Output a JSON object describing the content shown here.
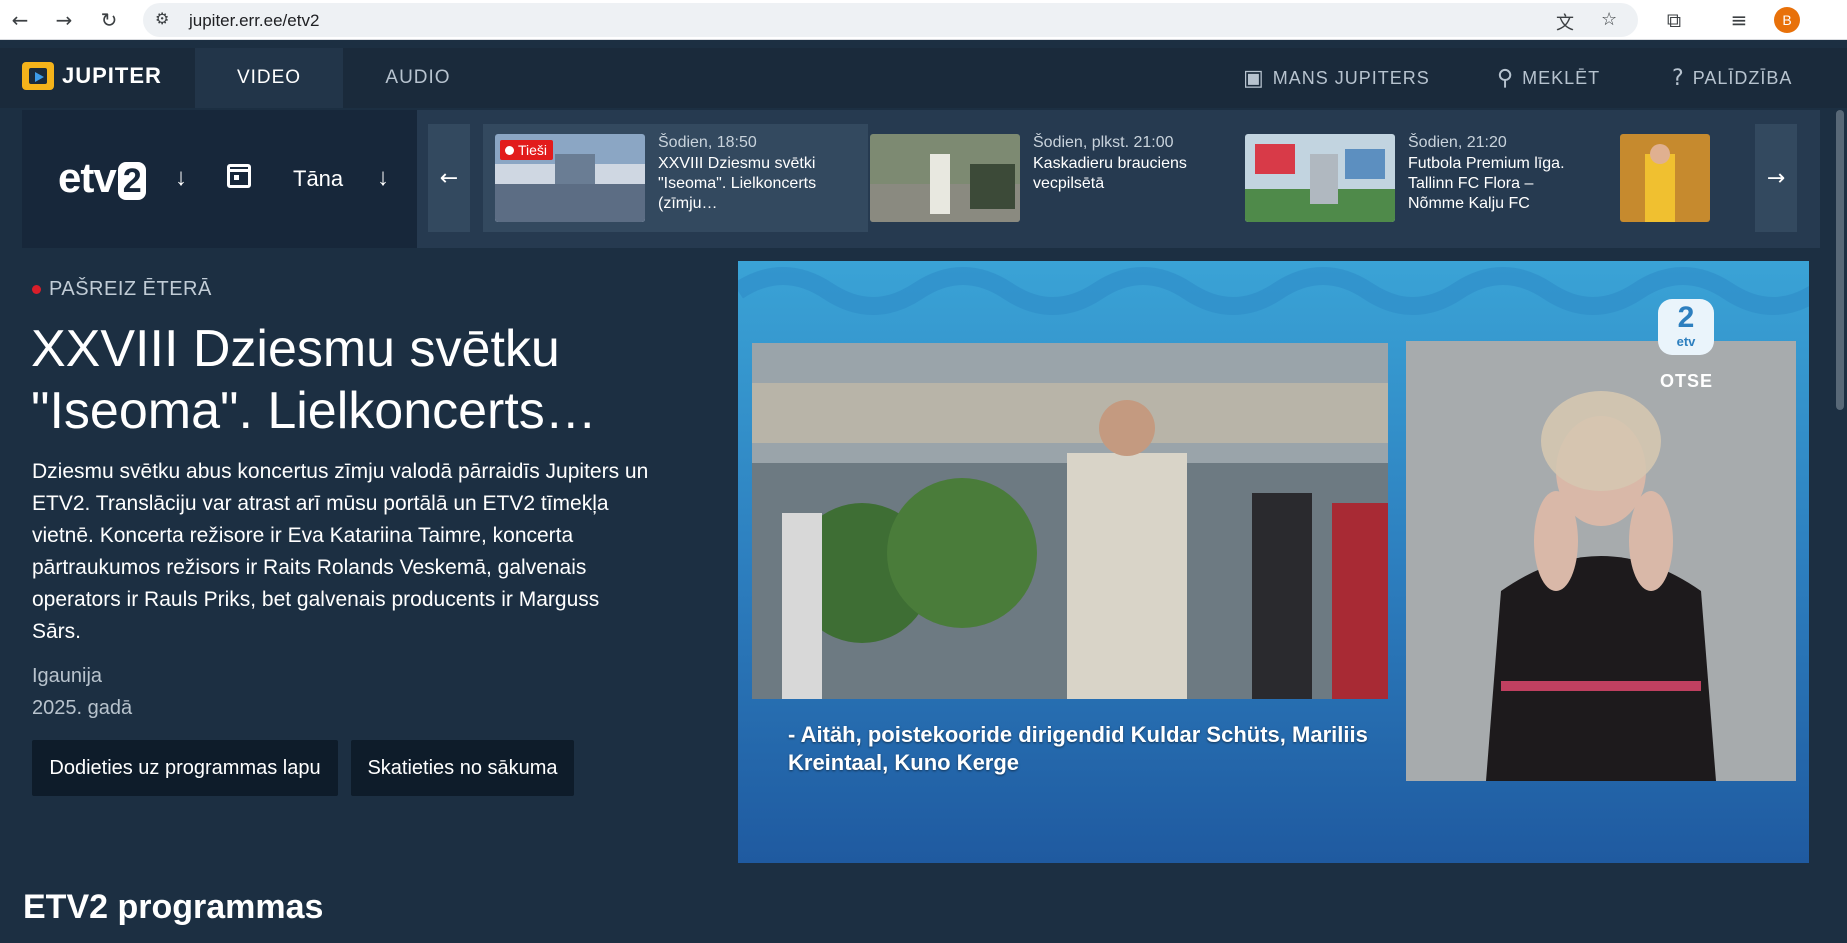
{
  "browser": {
    "url": "jupiter.err.ee/etv2",
    "back_icon": "arrow-left-icon",
    "forward_icon": "arrow-right-icon",
    "reload_icon": "reload-icon",
    "profile_initial": "B"
  },
  "header": {
    "logo_text": "JUPITER",
    "tabs": [
      {
        "label": "VIDEO",
        "active": true
      },
      {
        "label": "AUDIO",
        "active": false
      }
    ],
    "links": [
      {
        "label": "MANS JUPITERS",
        "icon": "playlist-icon"
      },
      {
        "label": "MEKLĒT",
        "icon": "search-icon"
      },
      {
        "label": "PALĪDZĪBA",
        "icon": "help-icon"
      }
    ]
  },
  "channel_strip": {
    "channel_logo": "etv",
    "channel_logo_num": "2",
    "day": "Tāna",
    "cards": [
      {
        "time": "Šodien, 18:50",
        "title": "XXVIII Dziesmu svētki \"Iseoma\". Lielkoncerts (zīmju…",
        "live_label": "Tieši",
        "active": true
      },
      {
        "time": "Šodien, plkst. 21:00",
        "title": "Kaskadieru brauciens vecpilsētā",
        "active": false
      },
      {
        "time": "Šodien, 21:20",
        "title": "Futbola Premium līga. Tallinn FC Flora – Nõmme Kalju FC",
        "active": false
      }
    ]
  },
  "now_playing": {
    "on_air_label": "PAŠREIZ ĒTERĀ",
    "title": "XXVIII Dziesmu svētku \"Iseoma\". Lielkoncerts…",
    "description": "Dziesmu svētku abus koncertus zīmju valodā pārraidīs Jupiters un ETV2. Translāciju var atrast arī mūsu portālā un ETV2 tīmekļa vietnē. Koncerta režisore ir Eva Katariina Taimre, koncerta pārtraukumos režisors ir Raits Rolands Veskemā, galvenais operators ir Rauls Priks, bet galvenais producents ir Marguss Sārs.",
    "country": "Igaunija",
    "year": "2025. gadā",
    "btn_program": "Dodieties uz programmas lapu",
    "btn_start": "Skatieties no sākuma"
  },
  "player": {
    "bug_num": "2",
    "bug_text": "etv",
    "live_text": "OTSE",
    "subtitle": "- Aitäh, poistekooride dirigendid Kuldar Schüts, Mariliis Kreintaal, Kuno Kerge"
  },
  "section": {
    "heading": "ETV2 programmas"
  },
  "colors": {
    "page_bg": "#1c2f42",
    "header_bg": "#1a2a3b",
    "live_red": "#e21b1b",
    "accent_yellow": "#f5b31a"
  }
}
